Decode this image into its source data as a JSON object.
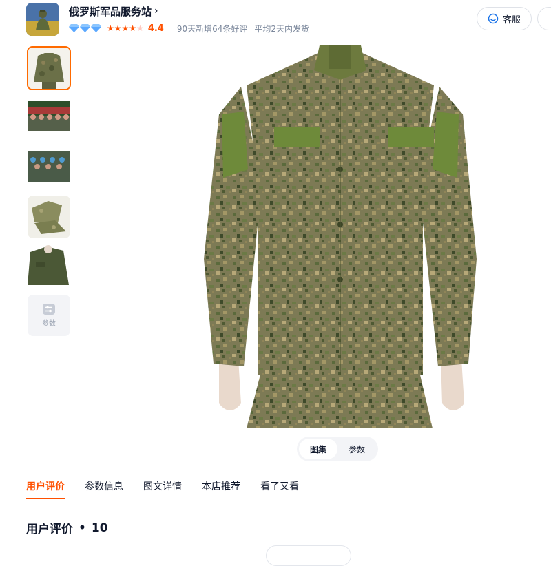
{
  "shop": {
    "name": "俄罗斯军品服务站",
    "rating": "4.4",
    "stat_reviews": "90天新增64条好评",
    "stat_shipping": "平均2天内发货",
    "stars_filled": 4,
    "stars_total": 5,
    "diamonds": 3
  },
  "header": {
    "service_label": "客服",
    "service_icon": "smiley-chat-icon"
  },
  "gallery": {
    "thumbnails": [
      "camo-jacket-front",
      "soldiers-parade-1",
      "soldiers-parade-2",
      "folded-uniform-set",
      "jacket-detail"
    ],
    "selected_index": 0,
    "params_label": "参数"
  },
  "view_switch": {
    "items": [
      "图集",
      "参数"
    ],
    "active": "图集"
  },
  "tabs": {
    "items": [
      "用户评价",
      "参数信息",
      "图文详情",
      "本店推荐",
      "看了又看"
    ],
    "active": "用户评价"
  },
  "reviews": {
    "title": "用户评价",
    "separator": "•",
    "count": "10"
  },
  "colors": {
    "accent": "#ff5000",
    "selected_border": "#ff6a00",
    "text_primary": "#11192d",
    "text_secondary": "#7c889c",
    "diamond": "#5aa8ff",
    "star_empty": "#ffc9c0"
  }
}
